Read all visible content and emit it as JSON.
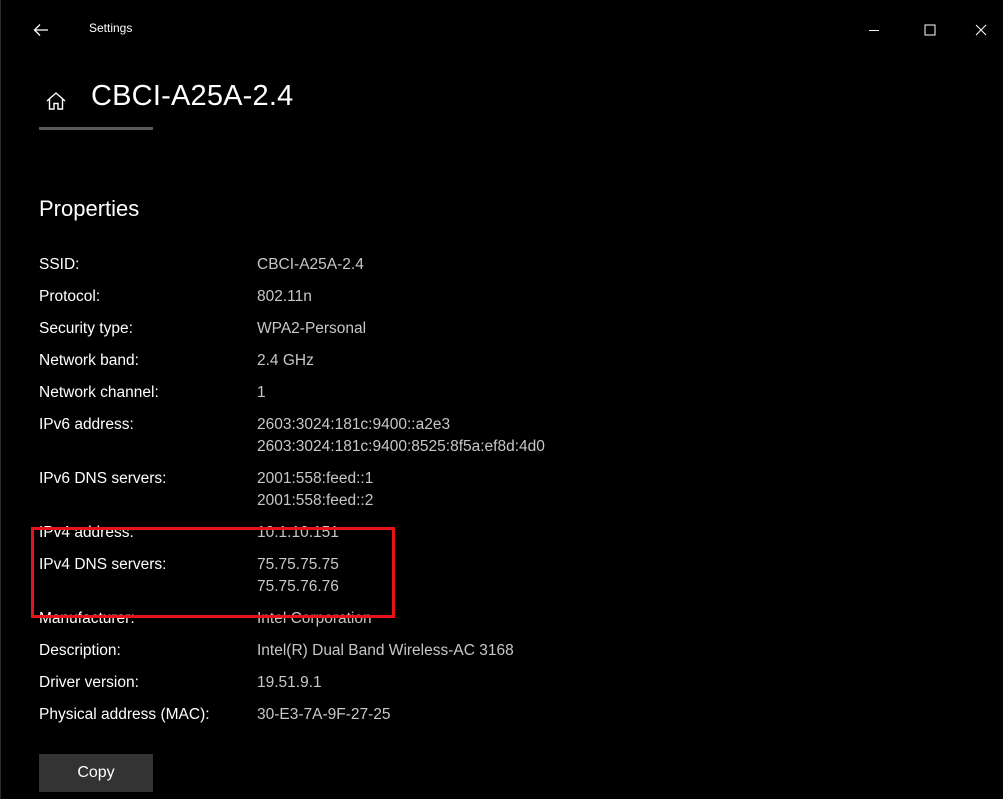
{
  "window": {
    "title": "Settings"
  },
  "header": {
    "title": "CBCI-A25A-2.4"
  },
  "properties": {
    "section_title": "Properties",
    "rows": [
      {
        "label": "SSID:",
        "values": [
          "CBCI-A25A-2.4"
        ]
      },
      {
        "label": "Protocol:",
        "values": [
          "802.11n"
        ]
      },
      {
        "label": "Security type:",
        "values": [
          "WPA2-Personal"
        ]
      },
      {
        "label": "Network band:",
        "values": [
          "2.4 GHz"
        ]
      },
      {
        "label": "Network channel:",
        "values": [
          "1"
        ]
      },
      {
        "label": "IPv6 address:",
        "values": [
          "2603:3024:181c:9400::a2e3",
          "2603:3024:181c:9400:8525:8f5a:ef8d:4d0"
        ]
      },
      {
        "label": "IPv6 DNS servers:",
        "values": [
          "2001:558:feed::1",
          "2001:558:feed::2"
        ]
      },
      {
        "label": "IPv4 address:",
        "values": [
          "10.1.10.151"
        ]
      },
      {
        "label": "IPv4 DNS servers:",
        "values": [
          "75.75.75.75",
          "75.75.76.76"
        ]
      },
      {
        "label": "Manufacturer:",
        "values": [
          "Intel Corporation"
        ]
      },
      {
        "label": "Description:",
        "values": [
          "Intel(R) Dual Band Wireless-AC 3168"
        ]
      },
      {
        "label": "Driver version:",
        "values": [
          "19.51.9.1"
        ]
      },
      {
        "label": "Physical address (MAC):",
        "values": [
          "30-E3-7A-9F-27-25"
        ]
      }
    ],
    "copy_label": "Copy"
  },
  "colors": {
    "background": "#000000",
    "highlight": "#e8121a",
    "value_text": "#c7c7c7",
    "button": "#333333"
  },
  "icons": {
    "back": "back-arrow-icon",
    "home": "home-icon",
    "minimize": "minimize-icon",
    "maximize": "maximize-icon",
    "close": "close-icon"
  }
}
